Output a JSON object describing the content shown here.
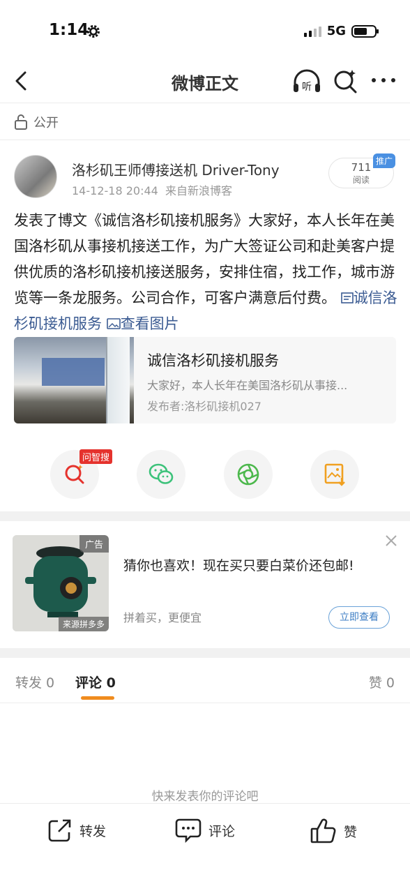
{
  "status_bar": {
    "time": "1:14",
    "network": "5G"
  },
  "nav": {
    "title": "微博正文"
  },
  "visibility": {
    "label": "公开"
  },
  "author": {
    "name": "洛杉矶王师傅接送机 Driver-Tony",
    "time": "14-12-18 20:44",
    "source": "来自新浪博客",
    "reads_count": "711",
    "reads_label": "阅读",
    "promo_label": "推广"
  },
  "post": {
    "text": "发表了博文《诚信洛杉矶接机服务》大家好，本人长年在美国洛杉矶从事接机接送工作，为广大签证公司和赴美客户提供优质的洛杉矶接机接送服务，安排住宿，找工作，城市游览等一条龙服务。公司合作，可客户满意后付费。",
    "article_link": "诚信洛杉矶接机服务",
    "image_link": "查看图片"
  },
  "article_card": {
    "title": "诚信洛杉矶接机服务",
    "desc": "大家好，本人长年在美国洛杉矶从事接...",
    "author": "发布者:洛杉矶接机027"
  },
  "share": {
    "search_tag": "问智搜"
  },
  "ad": {
    "tag": "广告",
    "source": "来源拼多多",
    "title": "猜你也喜欢！现在买只要白菜价还包邮!",
    "subtitle": "拼着买，更便宜",
    "button": "立即查看"
  },
  "tabs": {
    "share": "转发 0",
    "comment": "评论 0",
    "like": "赞 0"
  },
  "empty_hint": "快来发表你的评论吧",
  "bottom_bar": {
    "share": "转发",
    "comment": "评论",
    "like": "赞"
  },
  "colors": {
    "accent_orange": "#f08c1e",
    "link_blue": "#3b5b92",
    "wechat_green": "#3cc27a",
    "moments_green": "#4cb84c",
    "search_red": "#e5322d",
    "gallery_orange": "#f0a020"
  }
}
